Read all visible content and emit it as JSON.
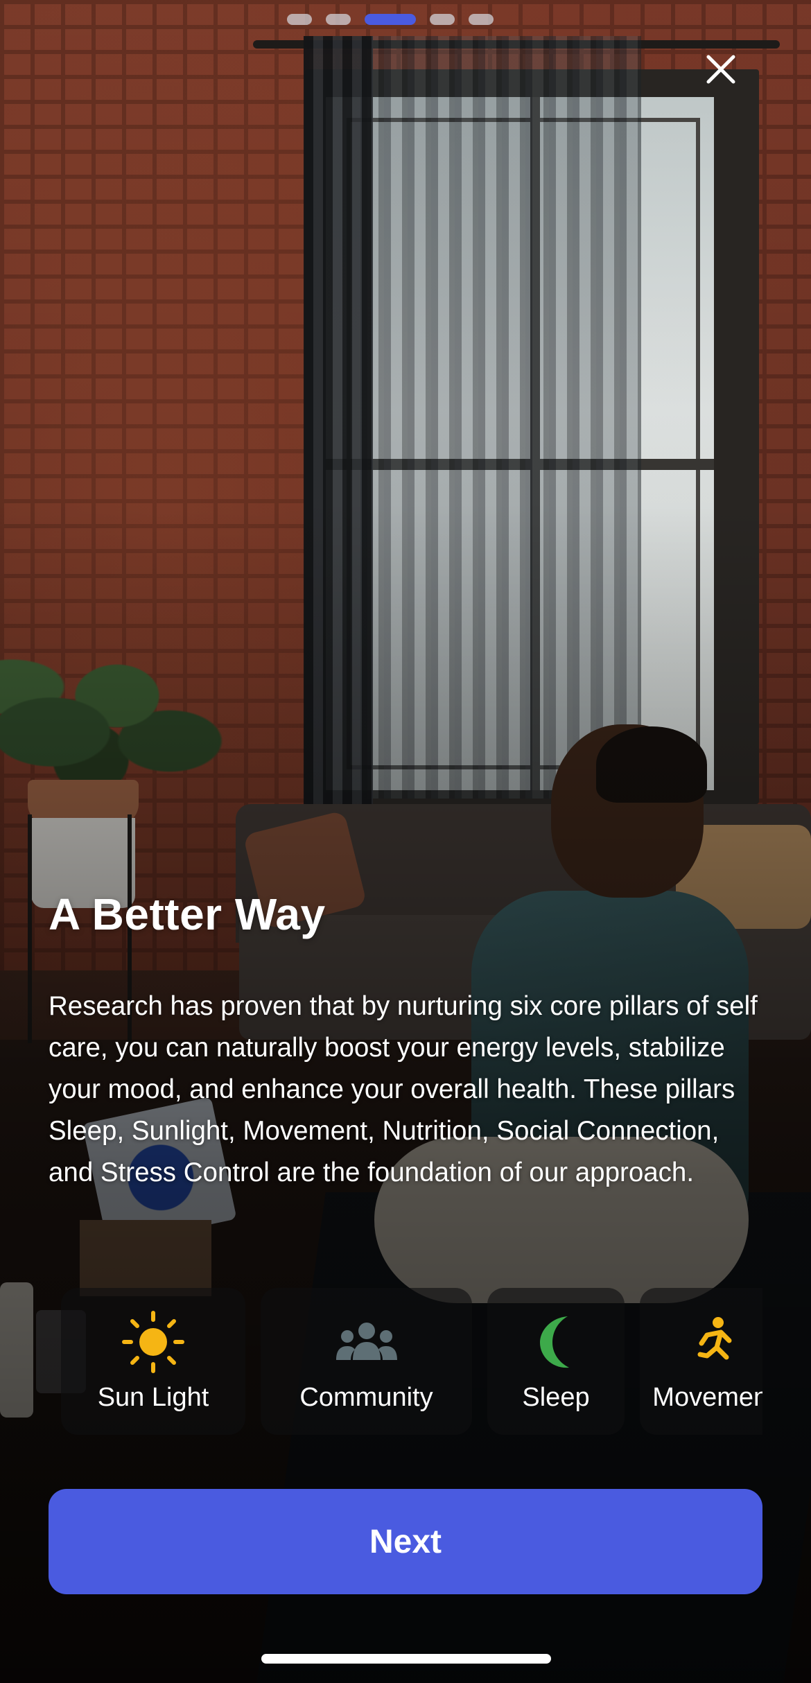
{
  "pager": {
    "pages": 5,
    "active_index": 2
  },
  "close": {
    "icon": "close-icon"
  },
  "content": {
    "title": "A Better Way",
    "body": "Research has proven that by nurturing six core pillars of self care, you can naturally boost your energy levels, stabilize your mood, and enhance your overall health. These pillars Sleep, Sunlight, Movement, Nutrition, Social Connection, and Stress Control are the foundation of our approach."
  },
  "pillars": [
    {
      "label": "Sun Light",
      "icon": "sun-icon",
      "color": "#F5B514"
    },
    {
      "label": "Community",
      "icon": "community-icon",
      "color": "#5E6F75"
    },
    {
      "label": "Sleep",
      "icon": "moon-icon",
      "color": "#3DAA4A"
    },
    {
      "label": "Movement",
      "icon": "movement-icon",
      "color": "#F5B514"
    }
  ],
  "next_button": {
    "label": "Next"
  },
  "colors": {
    "accent": "#4A5BE0",
    "pager_inactive": "#D2D2D7"
  }
}
